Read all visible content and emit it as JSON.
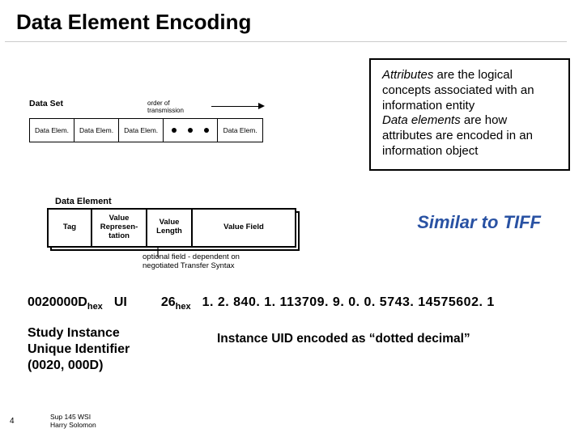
{
  "title": "Data Element Encoding",
  "data_set": {
    "label": "Data Set",
    "order_label": "order of transmission",
    "cells": [
      "Data Elem.",
      "Data Elem.",
      "Data Elem.",
      "Data Elem."
    ]
  },
  "data_element": {
    "label": "Data Element",
    "fields": {
      "tag": "Tag",
      "vr": "Value\nRepresen-\ntation",
      "vl": "Value\nLength",
      "vf": "Value Field"
    },
    "optional_note_l1": "optional field - dependent on",
    "optional_note_l2": "negotiated Transfer Syntax"
  },
  "callout": {
    "attr_line_em": "Attributes",
    "attr_line_rest": " are the logical concepts associated with an information entity",
    "elem_line_em": "Data elements",
    "elem_line_rest": " are how attributes are encoded in an information object"
  },
  "tiff": "Similar to TIFF",
  "example": {
    "tag_hex": "0020000D",
    "tag_sub": "hex",
    "vr": "UI",
    "len": "26",
    "len_sub": "hex",
    "uid": "1. 2. 840. 1. 113709. 9. 0. 0. 5743. 14575602. 1",
    "study_l1": "Study Instance",
    "study_l2": "Unique Identifier",
    "study_l3": "(0020, 000D)",
    "enc_note": "Instance UID encoded as “dotted decimal”"
  },
  "footer": {
    "page": "4",
    "l1": "Sup 145 WSI",
    "l2": "Harry Solomon"
  }
}
